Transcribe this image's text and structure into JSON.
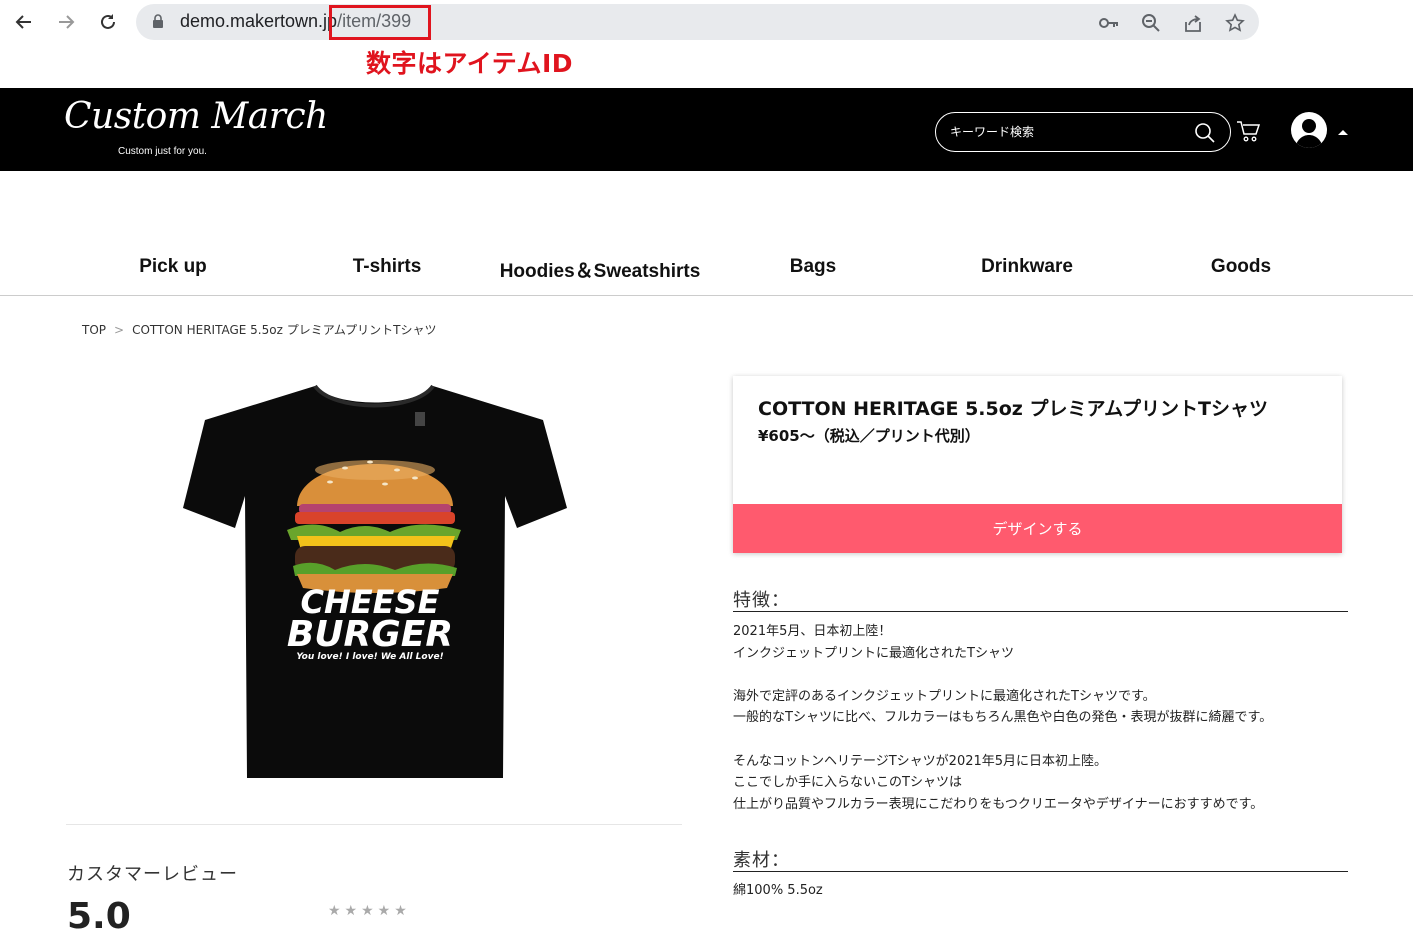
{
  "browser": {
    "url_host": "demo.makertown.jp",
    "url_path": "/item/399",
    "annotation": "数字はアイテムID"
  },
  "header": {
    "logo_title": "Custom March",
    "logo_tagline": "Custom just for you.",
    "search_placeholder": "キーワード検索"
  },
  "categories": [
    "Pick up",
    "T-shirts",
    "Hoodies＆Sweatshirts",
    "Bags",
    "Drinkware",
    "Goods"
  ],
  "breadcrumb": {
    "home": "TOP",
    "separator": ">",
    "current": "COTTON HERITAGE 5.5oz プレミアムプリントTシャツ"
  },
  "product": {
    "title": "COTTON HERITAGE 5.5oz プレミアムプリントTシャツ",
    "price": "¥605～（税込／プリント代別）",
    "design_button": "デザインする",
    "print_line1": "CHEESE",
    "print_line2": "BURGER",
    "print_line3": "You love! I love! We All Love!"
  },
  "features": {
    "heading": "特徴：",
    "lines": [
      "2021年5月、日本初上陸！",
      "インクジェットプリントに最適化されたTシャツ",
      "",
      "海外で定評のあるインクジェットプリントに最適化されたTシャツです。",
      "一般的なTシャツに比べ、フルカラーはもちろん黒色や白色の発色・表現が抜群に綺麗です。",
      "",
      "そんなコットンヘリテージTシャツが2021年5月に日本初上陸。",
      "ここでしか手に入らないこのTシャツは",
      "仕上がり品質やフルカラー表現にこだわりをもつクリエータやデザイナーにおすすめです。"
    ]
  },
  "material": {
    "heading": "素材：",
    "value": "綿100% 5.5oz"
  },
  "reviews": {
    "title": "カスタマーレビュー",
    "rating": "5.0",
    "stars": "★★★★★"
  },
  "colors": {
    "accent": "#ff5a6e",
    "annotation_red": "#e0141e",
    "header_bg": "#000000"
  }
}
